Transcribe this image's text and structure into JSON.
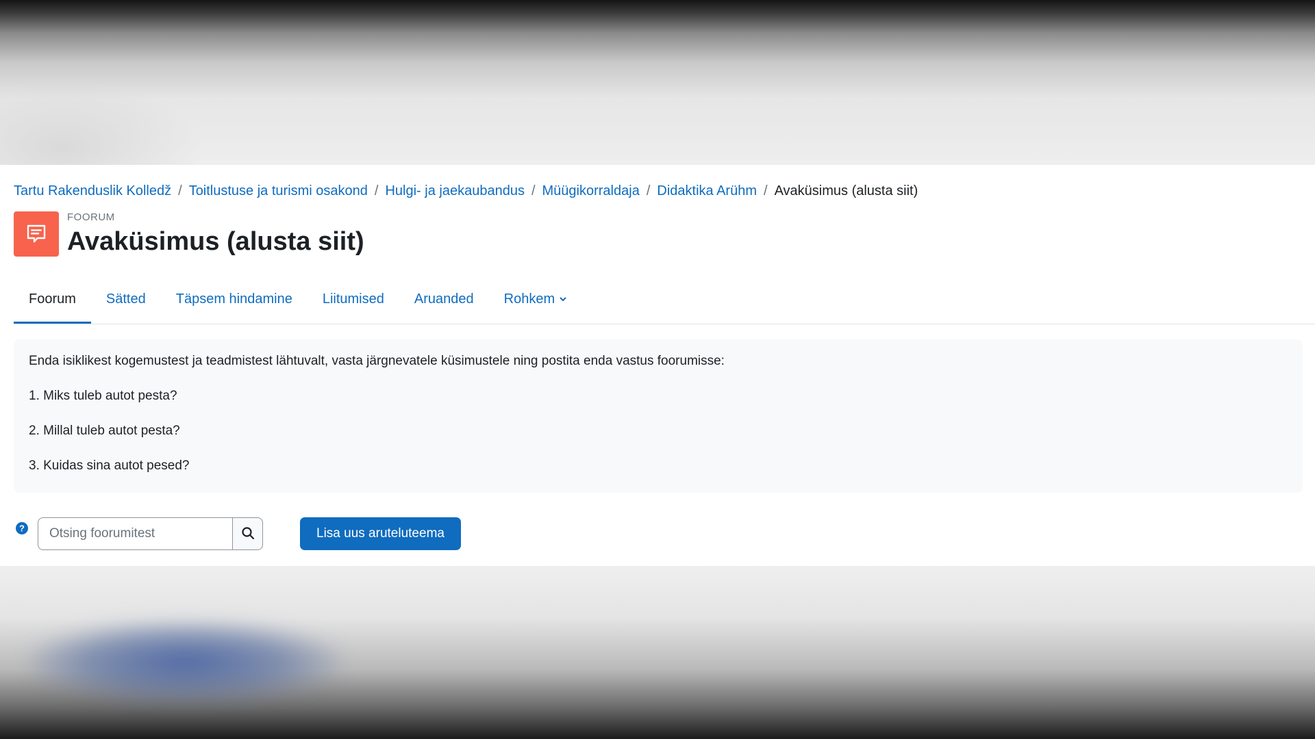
{
  "breadcrumb": {
    "items": [
      "Tartu Rakenduslik Kolledž",
      "Toitlustuse ja turismi osakond",
      "Hulgi- ja jaekaubandus",
      "Müügikorraldaja",
      "Didaktika Arühm"
    ],
    "current": "Avaküsimus (alusta siit)"
  },
  "header": {
    "pre_title": "FOORUM",
    "title": "Avaküsimus (alusta siit)",
    "icon": "forum-icon",
    "icon_color": "#f7634d"
  },
  "tabs": [
    {
      "label": "Foorum",
      "active": true
    },
    {
      "label": "Sätted",
      "active": false
    },
    {
      "label": "Täpsem hindamine",
      "active": false
    },
    {
      "label": "Liitumised",
      "active": false
    },
    {
      "label": "Aruanded",
      "active": false
    },
    {
      "label": "Rohkem",
      "active": false
    }
  ],
  "intro": {
    "paragraphs": [
      "Enda isiklikest kogemustest ja teadmistest lähtuvalt, vasta järgnevatele küsimustele ning postita enda vastus foorumisse:",
      "1. Miks tuleb autot pesta?",
      "2. Millal tuleb autot pesta?",
      "3. Kuidas sina autot pesed?"
    ]
  },
  "search": {
    "placeholder": "Otsing foorumitest",
    "value": ""
  },
  "actions": {
    "add_discussion_label": "Lisa uus aruteluteema"
  },
  "colors": {
    "link": "#0f6cbf",
    "primary": "#0f6cbf",
    "help": "#0f6cbf"
  }
}
